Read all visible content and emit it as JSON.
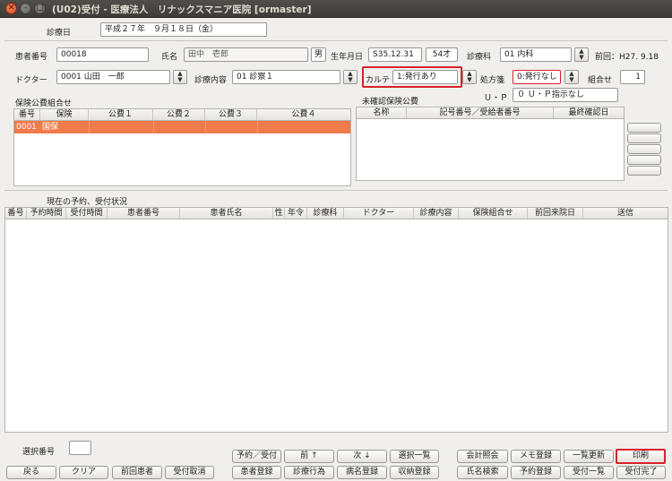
{
  "window": {
    "title": "(U02)受付 - 医療法人　リナックスマニア医院 [ormaster]",
    "close_glyph": "✕",
    "min_glyph": "–",
    "max_glyph": "□"
  },
  "header": {
    "shinryobi_label": "診療日",
    "shinryobi_value": "平成２７年　９月１８日（金）"
  },
  "patient": {
    "kanja_bango_label": "患者番号",
    "kanja_bango_value": "00018",
    "shimei_label": "氏名",
    "shimei_value": "田中　壱郎",
    "sex_value": "男",
    "birth_label": "生年月日",
    "birth_value": "S35.12.31",
    "age_value": "54才",
    "shinryoka_label": "診療科",
    "shinryoka_value": "01 内科",
    "zenkai_text": "前回：H27. 9.18"
  },
  "doctor": {
    "doctor_label": "ドクター",
    "doctor_value": "0001 山田　一郎",
    "naiyo_label": "診療内容",
    "naiyo_value": "01 診察１",
    "karte_label": "カルテ",
    "karte_value": "1:発行あり",
    "shohosen_label": "処方箋",
    "shohosen_value": "0:発行なし",
    "kumiawase_label": "組合せ",
    "kumiawase_value": "1",
    "up_label": "Ｕ・Ｐ",
    "up_value": "０ Ｕ・Ｐ指示なし"
  },
  "hoken": {
    "section_label": "保険公費組合せ",
    "columns": [
      "番号",
      "保険",
      "公費１",
      "公費２",
      "公費３",
      "公費４"
    ],
    "rows": [
      {
        "bango": "0001",
        "hoken": "国保"
      }
    ]
  },
  "mikakunin": {
    "section_label": "未確認保険公費",
    "columns": [
      "名称",
      "記号番号／受給者番号",
      "最終確認日"
    ]
  },
  "yoyaku": {
    "section_label": "現在の予約、受付状況",
    "columns": [
      "番号",
      "予約時間",
      "受付時間",
      "患者番号",
      "患者氏名",
      "性",
      "年令",
      "診療科",
      "ドクター",
      "診療内容",
      "保険組合せ",
      "前回来院日",
      "送信"
    ]
  },
  "footer": {
    "sentaku_label": "選択番号",
    "sentaku_value": "",
    "buttons_top": [
      "予約／受付",
      "前 ↑",
      "次 ↓",
      "選択一覧",
      "会計照会",
      "メモ登録",
      "一覧更新",
      "印刷"
    ],
    "buttons_bottom": [
      "戻る",
      "クリア",
      "前回患者",
      "受付取消",
      "患者登録",
      "診療行為",
      "病名登録",
      "収納登録",
      "氏名検索",
      "予約登録",
      "受付一覧",
      "受付完了"
    ]
  },
  "colors": {
    "selected_row": "#f07b4a",
    "highlight_border": "#d8222a"
  }
}
